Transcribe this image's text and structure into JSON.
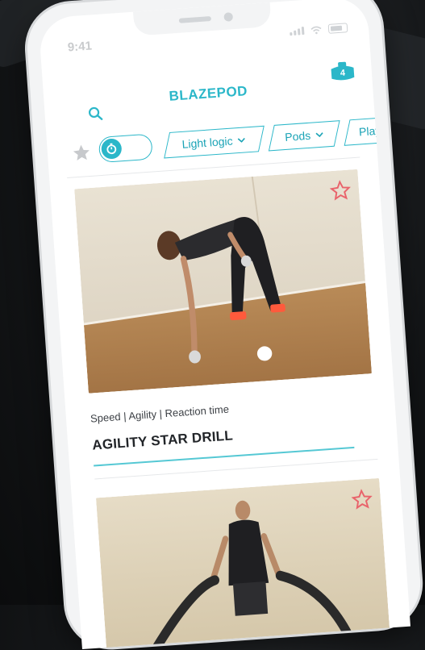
{
  "status_bar": {
    "time": "9:41"
  },
  "app": {
    "title": "BLAZEPOD",
    "pods_count": "4"
  },
  "filters": [
    {
      "label": "Light logic"
    },
    {
      "label": "Pods"
    },
    {
      "label": "Player"
    }
  ],
  "cards": [
    {
      "tags": "Speed | Agility | Reaction time",
      "title": "AGILITY STAR DRILL"
    },
    {
      "tags": "",
      "title": ""
    }
  ],
  "colors": {
    "accent": "#2bb7c9",
    "star": "#e9636b"
  },
  "icons": {
    "search": "search-icon",
    "pods": "pods-icon",
    "favorite": "star-icon",
    "timer": "timer-icon",
    "chevron": "chevron-down-icon"
  }
}
